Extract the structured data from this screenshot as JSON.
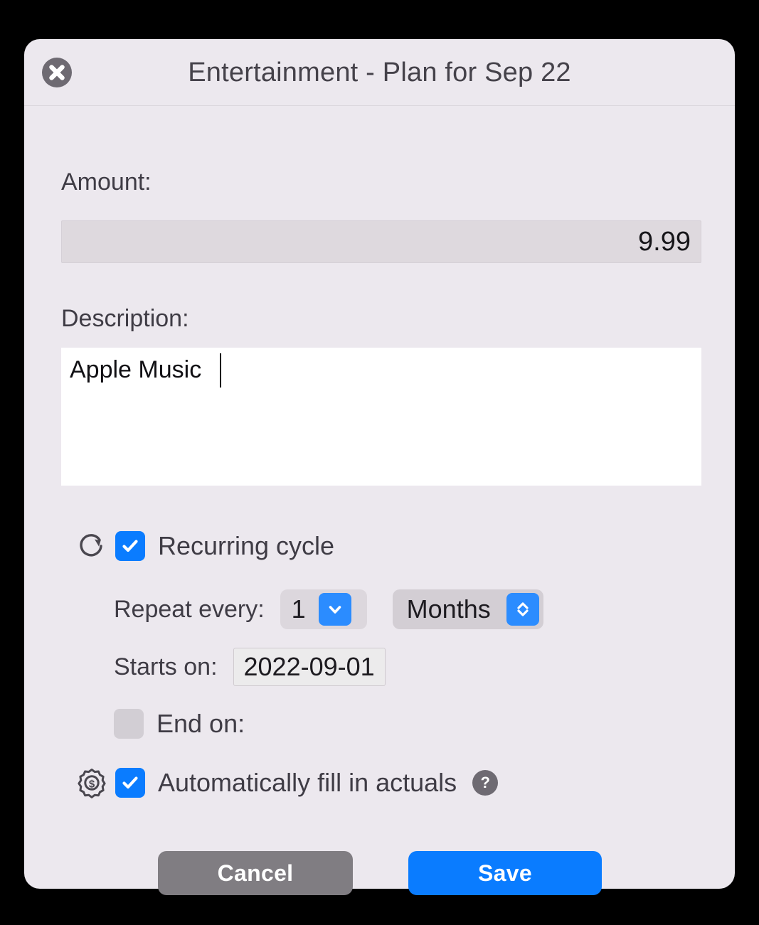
{
  "window": {
    "title": "Entertainment - Plan for Sep 22",
    "close_icon": "close-icon"
  },
  "form": {
    "amount": {
      "label": "Amount:",
      "value": "9.99",
      "placeholder": ""
    },
    "description": {
      "label": "Description:",
      "value": "Apple Music",
      "placeholder": ""
    },
    "recurring": {
      "icon": "refresh-cycle-icon",
      "label": "Recurring cycle",
      "checked": true
    },
    "repeat": {
      "label": "Repeat every:",
      "count_value": "1",
      "count_icon": "chevron-down-icon",
      "unit_value": "Months",
      "unit_icon": "chevron-up-down-icon"
    },
    "starts_on": {
      "label": "Starts on:",
      "value": "2022-09-01"
    },
    "end_on": {
      "label": "End on:",
      "checked": false
    },
    "autofill": {
      "icon": "gear-dollar-icon",
      "label": "Automatically fill in actuals",
      "checked": true,
      "help_icon": "help-circle-icon",
      "help_glyph": "?"
    }
  },
  "footer": {
    "cancel_label": "Cancel",
    "save_label": "Save"
  },
  "colors": {
    "accent_blue": "#0a7cff",
    "chip_blue": "#2b8cff",
    "cancel_gray": "#807d82",
    "surface": "#ece8ee",
    "text": "#3f3c45"
  }
}
